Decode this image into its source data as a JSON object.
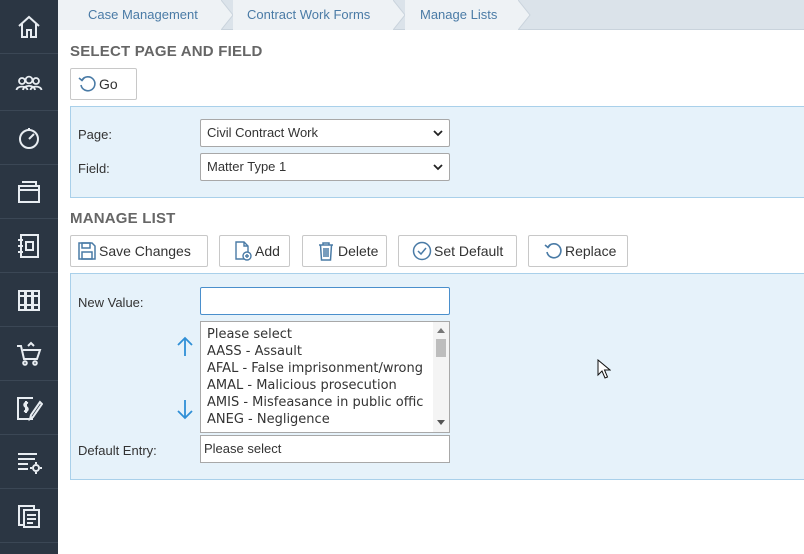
{
  "sidebar": {
    "items": [
      {
        "icon": "home-icon"
      },
      {
        "icon": "people-icon"
      },
      {
        "icon": "dashboard-icon"
      },
      {
        "icon": "archive-icon"
      },
      {
        "icon": "contacts-book-icon"
      },
      {
        "icon": "library-icon"
      },
      {
        "icon": "cart-icon"
      },
      {
        "icon": "billing-edit-icon"
      },
      {
        "icon": "list-settings-icon"
      },
      {
        "icon": "documents-icon"
      }
    ]
  },
  "breadcrumb": {
    "items": [
      "Case Management",
      "Contract Work Forms",
      "Manage Lists"
    ]
  },
  "select_section": {
    "title": "SELECT PAGE AND FIELD",
    "go_label": "Go",
    "page_label": "Page:",
    "page_value": "Civil Contract Work",
    "field_label": "Field:",
    "field_value": "Matter Type 1"
  },
  "manage_section": {
    "title": "MANAGE LIST",
    "buttons": {
      "save": "Save Changes",
      "add": "Add",
      "delete": "Delete",
      "set_default": "Set Default",
      "replace": "Replace"
    },
    "new_value_label": "New Value:",
    "new_value": "",
    "list_items": [
      "Please select",
      "AASS - Assault",
      "AFAL - False imprisonment/wrong",
      "AMAL - Malicious prosecution",
      "AMIS - Misfeasance in public offic",
      "ANEG - Negligence"
    ],
    "default_entry_label": "Default Entry:",
    "default_entry_value": "Please select"
  },
  "colors": {
    "sidebar_bg": "#2b3643",
    "link": "#4a7ba6",
    "panel_bg": "#e6f2fa",
    "panel_border": "#a9d0ea",
    "icon_blue": "#2f8fd6"
  }
}
